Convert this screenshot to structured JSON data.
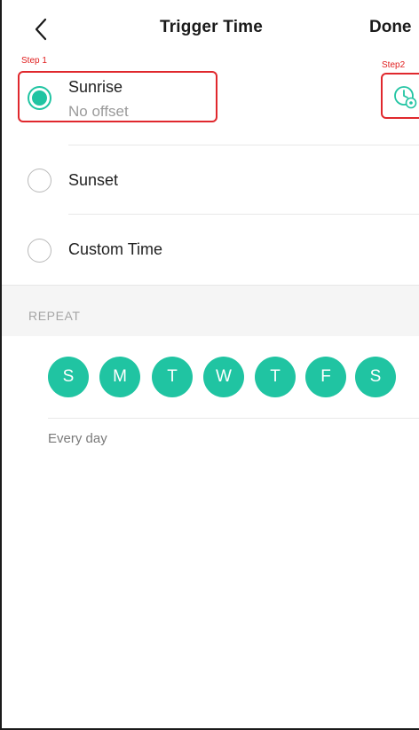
{
  "header": {
    "title": "Trigger Time",
    "done_label": "Done",
    "back_icon": "chevron-left-icon"
  },
  "annotations": {
    "step1": "Step 1",
    "step2": "Step2",
    "highlight_color": "#e0282d"
  },
  "options": [
    {
      "label": "Sunrise",
      "sublabel": "No offset",
      "selected": true
    },
    {
      "label": "Sunset",
      "selected": false
    },
    {
      "label": "Custom Time",
      "selected": false
    }
  ],
  "offset_settings_icon": "clock-gear-icon",
  "repeat": {
    "header": "REPEAT",
    "days": [
      "S",
      "M",
      "T",
      "W",
      "T",
      "F",
      "S"
    ],
    "all_selected": true,
    "summary": "Every day"
  },
  "colors": {
    "accent": "#20c4a2",
    "text": "#222222",
    "secondary_text": "#9a9a9a",
    "section_bg": "#f5f5f5"
  }
}
